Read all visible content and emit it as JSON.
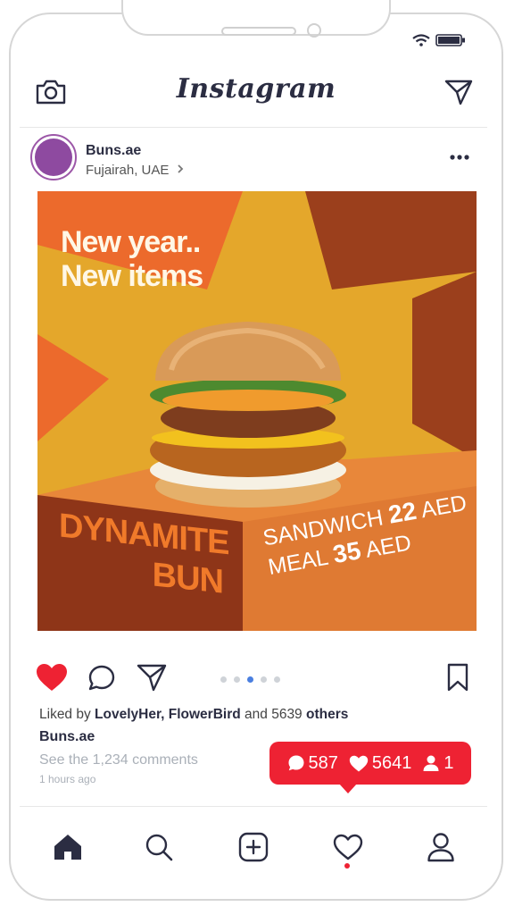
{
  "app": {
    "title": "Instagram"
  },
  "post": {
    "username": "Buns.ae",
    "location": "Fujairah, UAE",
    "image": {
      "headline_line1": "New year..",
      "headline_line2": "New items",
      "product_line1": "DYNAMITE",
      "product_line2": "BUN",
      "sandwich_label": "SANDWICH",
      "sandwich_price": "22",
      "meal_label": "MEAL",
      "meal_price": "35",
      "currency": "AED"
    },
    "carousel": {
      "count": 5,
      "active": 3
    },
    "liked_prefix": "Liked by",
    "liked_users": "LovelyHer, FlowerBird",
    "liked_mid": "and 5639",
    "liked_suffix": "others",
    "caption_user": "Buns.ae",
    "comments_link": "See the 1,234 comments",
    "time": "1 hours ago"
  },
  "notification": {
    "comments": "587",
    "likes": "5641",
    "followers": "1"
  },
  "colors": {
    "accent_red": "#ee2233",
    "text_dark": "#2b2d42",
    "avatar": "#8e4aa0",
    "active_dot": "#4a7fe0"
  },
  "icons": [
    "camera-icon",
    "direct-message-icon",
    "more-icon",
    "heart-filled-icon",
    "comment-icon",
    "share-icon",
    "bookmark-icon",
    "home-icon",
    "search-icon",
    "add-post-icon",
    "activity-icon",
    "profile-icon"
  ]
}
